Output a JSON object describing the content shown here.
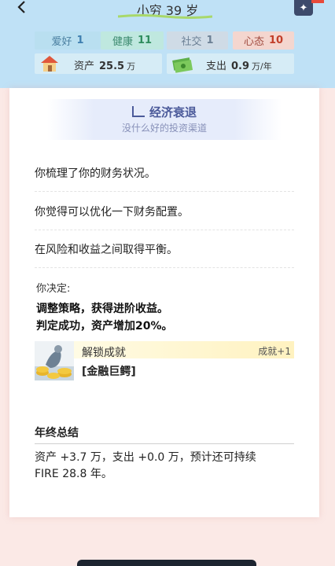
{
  "header": {
    "title": "小穷 39 岁",
    "stats": [
      {
        "label": "爱好",
        "value": "1"
      },
      {
        "label": "健康",
        "value": "11"
      },
      {
        "label": "社交",
        "value": "1"
      },
      {
        "label": "心态",
        "value": "10"
      }
    ],
    "assets": {
      "label": "资产",
      "value": "25.5",
      "unit": "万"
    },
    "expense": {
      "label": "支出",
      "value": "0.9",
      "unit": "万/年"
    }
  },
  "event": {
    "title": "经济衰退",
    "subtitle": "没什么好的投资渠道",
    "lines": [
      "你梳理了你的财务状况。",
      "你觉得可以优化一下财务配置。",
      "在风险和收益之间取得平衡。"
    ],
    "decide_label": "你决定:",
    "result_lines": [
      "调整策略，获得进阶收益。",
      "判定成功，资产增加20%。"
    ]
  },
  "achievement": {
    "unlock_label": "解锁成就",
    "name": "[金融巨鳄]",
    "badge": "成就+1"
  },
  "summary": {
    "title": "年终总结",
    "text": "资产 +3.7 万，支出 +0.0 万，预计还可持续 FIRE 28.8 年。"
  }
}
